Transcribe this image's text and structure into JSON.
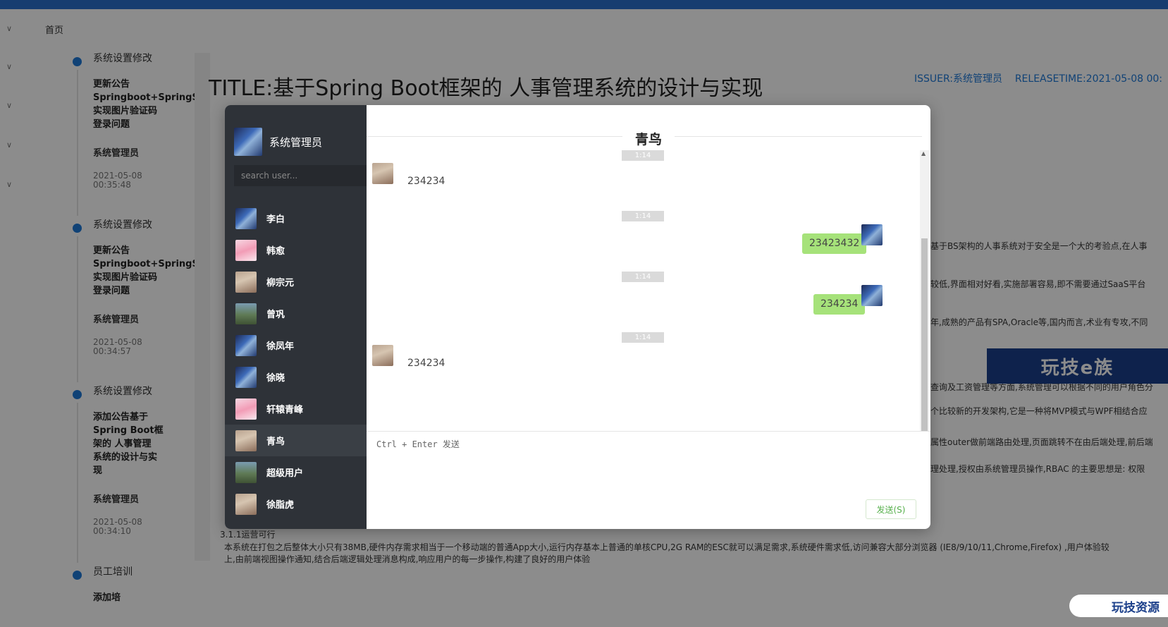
{
  "page": {
    "breadcrumb": "首页",
    "article_title": "TITLE:基于Spring Boot框架的 人事管理系统的设计与实现",
    "issuer": "ISSUER:系统管理员",
    "release_time": "RELEASETIME:2021-05-08 00:",
    "timeline": [
      {
        "title": "系统设置修改",
        "body": "更新公告\nSpringboot+SpringS\n实现图片验证码\n登录问题",
        "author": "系统管理员",
        "time": "2021-05-08\n00:35:48"
      },
      {
        "title": "系统设置修改",
        "body": "更新公告\nSpringboot+SpringS\n实现图片验证码\n登录问题",
        "author": "系统管理员",
        "time": "2021-05-08\n00:34:57"
      },
      {
        "title": "系统设置修改",
        "body": "添加公告基于\nSpring Boot框\n架的 人事管理\n系统的设计与实\n现",
        "author": "系统管理员",
        "time": "2021-05-08\n00:34:10"
      },
      {
        "title": "员工培训",
        "body": "添加培",
        "author": "",
        "time": ""
      }
    ],
    "fragments": [
      "基于BS架构的人事系统对于安全是一个大的考验点,在人事",
      "较低,界面相对好看,实施部署容易,即不需要通过SaaS平台",
      "年,成熟的产品有SPA,Oracle等,国内而言,术业有专攻,不同",
      "查询及工资管理等方面,系统管理可以根据不同的用户角色分",
      "个比较新的开发架构,它是一种将MVP模式与WPF相结合应",
      "属性outer做前端路由处理,页面跳转不在由后端处理,前后端",
      "理处理,授权由系统管理员操作,RBAC 的主要思想是: 权限"
    ],
    "section_label": "3.1.1运营可行",
    "bottom_line_1": "本系统在打包之后整体大小只有38MB,硬件内存需求相当于一个移动端的普通App大小,运行内存基本上普通的单核CPU,2G RAM的ESC就可以满足需求,系统硬件需求低,访问兼容大部分浏览器 (IE8/9/10/11,Chrome,Firefox) ,用户体验较",
    "bottom_line_2": "上,由前端视图操作通知,结合后端逻辑处理消息构成,响应用户的每一步操作,构建了良好的用户体验",
    "promo_text": "玩技e族",
    "badge_text": "玩技资源"
  },
  "chat": {
    "current_user": "系统管理员",
    "search_placeholder": "search user...",
    "contacts": [
      {
        "name": "李白",
        "avatar": "x"
      },
      {
        "name": "韩愈",
        "avatar": "pink"
      },
      {
        "name": "柳宗元",
        "avatar": "girl"
      },
      {
        "name": "曾巩",
        "avatar": "land"
      },
      {
        "name": "徐凤年",
        "avatar": "x"
      },
      {
        "name": "徐晓",
        "avatar": "x"
      },
      {
        "name": "轩辕青峰",
        "avatar": "pink"
      },
      {
        "name": "青鸟",
        "avatar": "girl",
        "active": true
      },
      {
        "name": "超级用户",
        "avatar": "land"
      },
      {
        "name": "徐脂虎",
        "avatar": "girl"
      }
    ],
    "peer_name": "青鸟",
    "messages": [
      {
        "time": "1:14",
        "direction": "in",
        "text": "234234"
      },
      {
        "time": "1:14",
        "direction": "out",
        "text": "23423432"
      },
      {
        "time": "1:14",
        "direction": "out",
        "text": "234234"
      },
      {
        "time": "1:14",
        "direction": "in",
        "text": "234234"
      }
    ],
    "input_placeholder": "Ctrl + Enter 发送",
    "send_label": "发送(S)"
  }
}
